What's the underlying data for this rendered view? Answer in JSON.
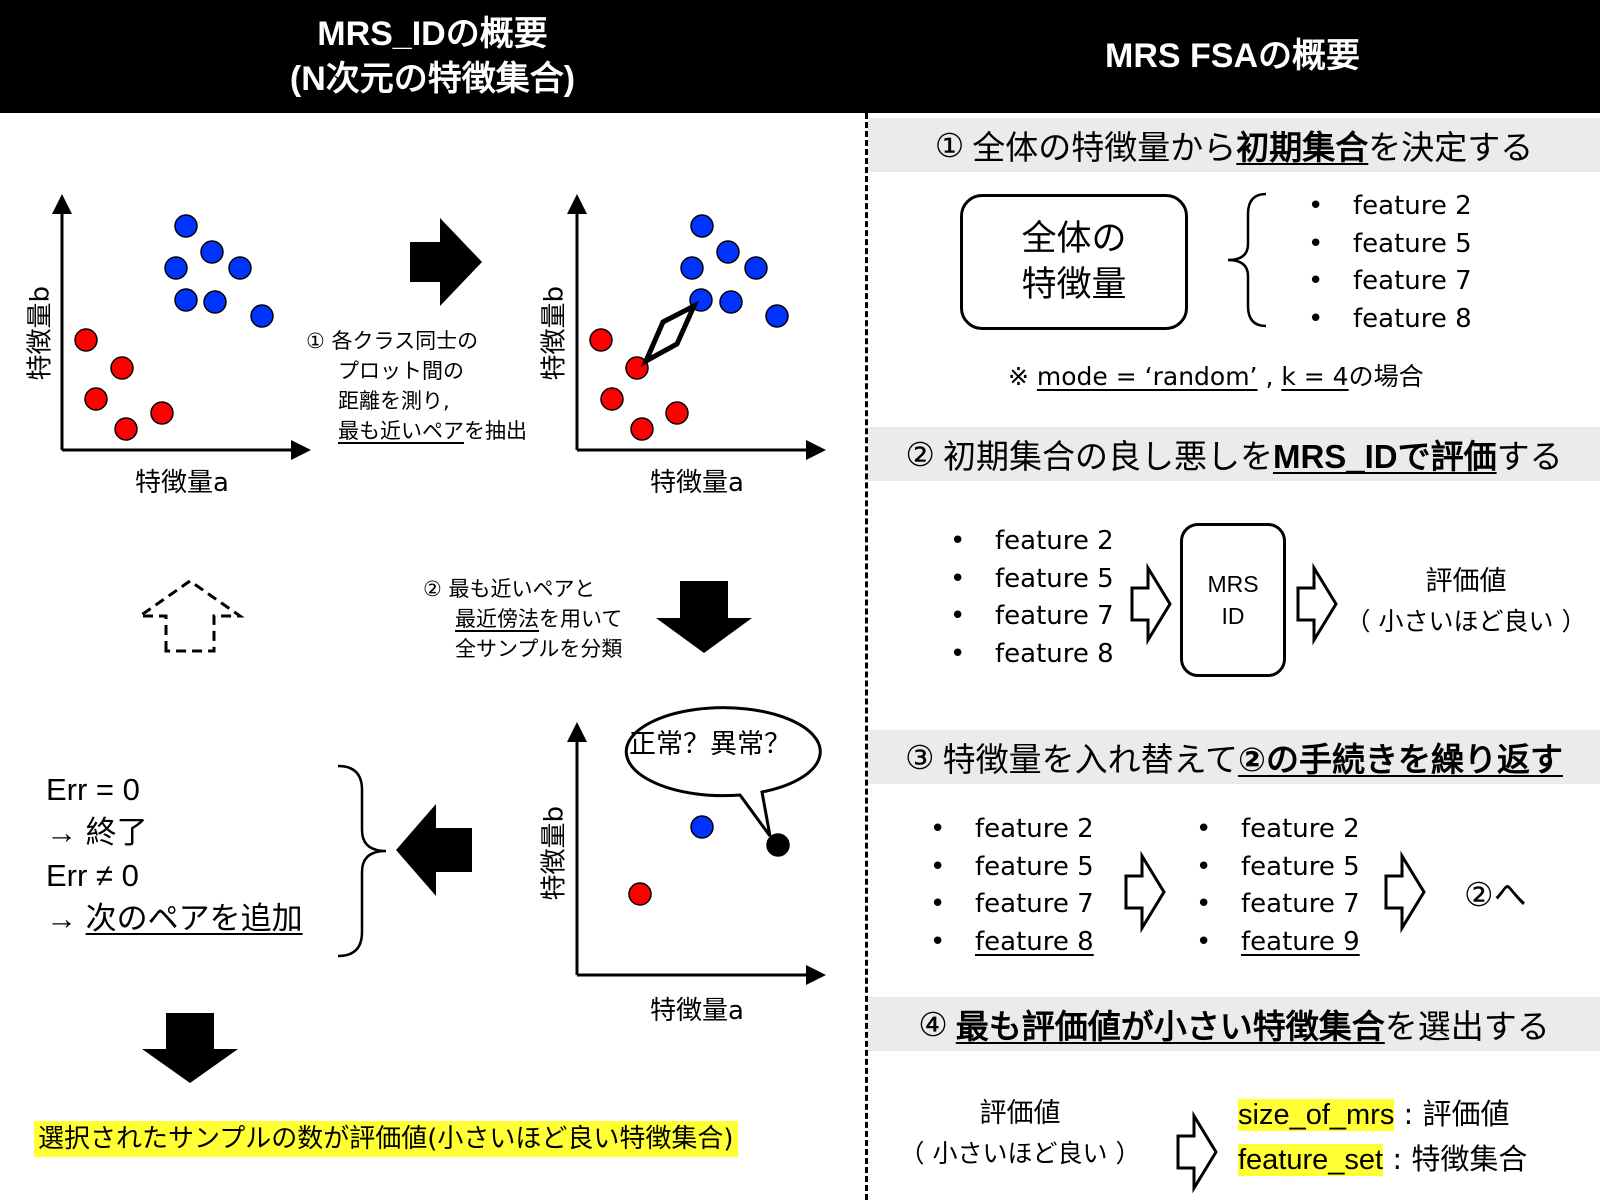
{
  "header": {
    "left_title_1": "MRS_IDの概要",
    "left_title_2": "(N次元の特徴集合)",
    "right_title": "MRS FSAの概要"
  },
  "left": {
    "axis_x": "特徴量a",
    "axis_y": "特徴量b",
    "step1_ann": {
      "line1": "① 各クラス同士の",
      "line2": "プロット間の",
      "line3": "距離を測り,",
      "line4": "最も近いペア",
      "line4_tail": "を抽出"
    },
    "step2_ann": {
      "line1": "② 最も近いペアと",
      "line2": "最近傍法",
      "line2_tail": "を用いて",
      "line3": "全サンプルを分類"
    },
    "bubble": "正常？異常？",
    "err": {
      "line1": "Err = 0",
      "line2": "→ 終了",
      "line3": "Err ≠ 0",
      "line4_arrow": "→ ",
      "line4": "次のペアを追加"
    },
    "result": "選択されたサンプルの数が評価値(小さいほど良い特徴集合)",
    "colors": {
      "red": "#ff0000",
      "blue": "#0033ff",
      "highlight": "#ffff33"
    }
  },
  "right": {
    "step1": {
      "num": "①",
      "pre": "全体の特徴量から",
      "u": "初期集合",
      "post": "を決定する",
      "box_line1": "全体の",
      "box_line2": "特徴量",
      "features": [
        "feature 2",
        "feature 5",
        "feature 7",
        "feature 8"
      ],
      "note_mark": "※",
      "note_mode": "mode = ‘random’",
      "note_sep": ",",
      "note_k": "k = 4",
      "note_tail": "の場合"
    },
    "step2": {
      "num": "②",
      "pre": "初期集合の良し悪しを",
      "u": "MRS_IDで評価",
      "post": "する",
      "features": [
        "feature 2",
        "feature 5",
        "feature 7",
        "feature 8"
      ],
      "box_line1": "MRS",
      "box_line2": "ID",
      "eval_line1": "評価値",
      "eval_line2": "（ 小さいほど良い ）"
    },
    "step3": {
      "num": "③",
      "pre": "特徴量を入れ替えて",
      "u": "②の手続きを繰り返す",
      "list_a": [
        "feature 2",
        "feature 5",
        "feature 7",
        "feature 8"
      ],
      "list_b": [
        "feature 2",
        "feature 5",
        "feature 7",
        "feature 9"
      ],
      "goto": "②へ"
    },
    "step4": {
      "num": "④",
      "u": "最も評価値が小さい特徴集合",
      "post": "を選出する",
      "eval_line1": "評価値",
      "eval_line2": "（ 小さいほど良い ）",
      "out1_key": "size_of_mrs",
      "out1_val": " : 評価値",
      "out2_key": "feature_set",
      "out2_val": " : 特徴集合"
    }
  },
  "bullet": "•"
}
